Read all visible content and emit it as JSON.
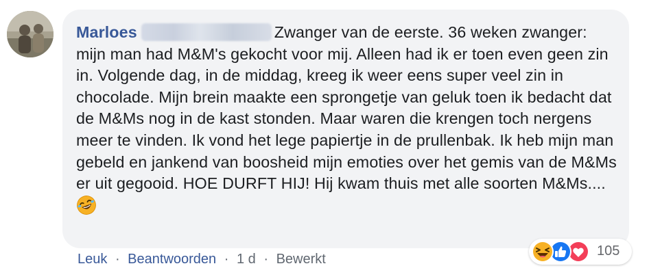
{
  "comment": {
    "author": "Marloes",
    "text": "Zwanger van de eerste. 36 weken zwanger: mijn man had M&M's gekocht voor mij. Alleen had ik er toen even geen zin in. Volgende dag, in de middag, kreeg ik weer eens super veel zin in chocolade. Mijn brein maakte een sprongetje van geluk toen ik bedacht dat de M&Ms nog in de kast stonden. Maar waren die krengen toch nergens meer te vinden. Ik vond het lege papiertje in de prullenbak. Ik heb mijn man gebeld en jankend van boosheid mijn emoties over het gemis van de M&Ms er uit gegooid. HOE DURFT HIJ! Hij kwam thuis met alle soorten M&Ms....",
    "inline_emoji": "rolling-on-floor-laughing-icon"
  },
  "reactions": {
    "icons": [
      "haha-reaction-icon",
      "like-reaction-icon",
      "love-reaction-icon"
    ],
    "count": "105"
  },
  "actions": {
    "like": "Leuk",
    "reply": "Beantwoorden",
    "time": "1 d",
    "edited": "Bewerkt",
    "separator": "·"
  },
  "colors": {
    "author": "#385898",
    "text": "#1c1e21",
    "bubble": "#f2f3f5",
    "meta": "#606770",
    "like_blue": "#1877f2",
    "love_red": "#f33e58",
    "haha_yellow": "#f7b125"
  }
}
